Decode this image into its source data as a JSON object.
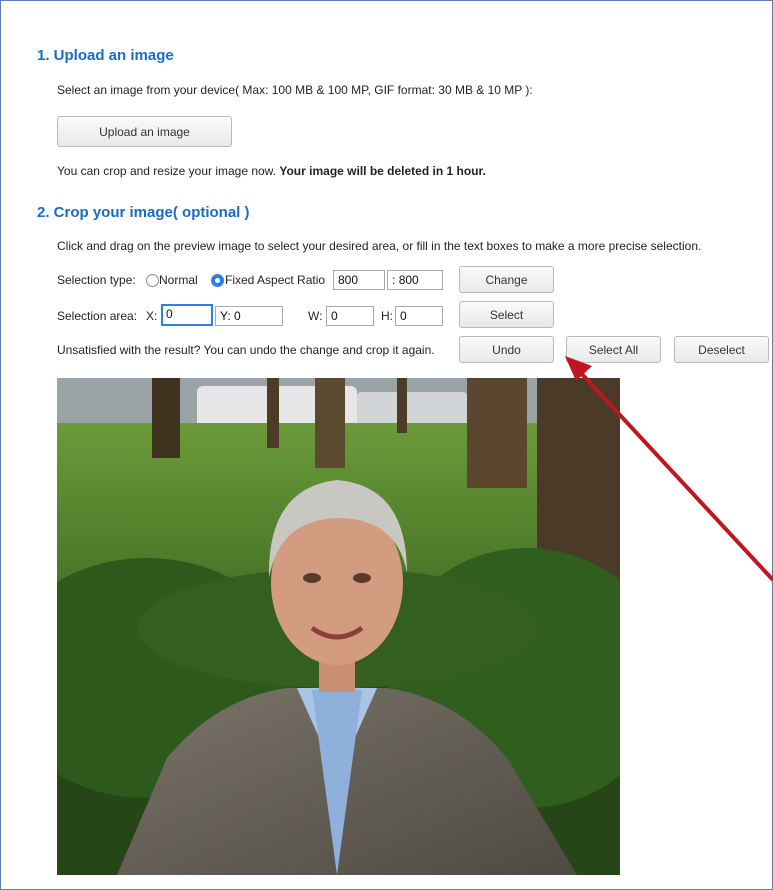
{
  "section1": {
    "heading": "1. Upload an image",
    "description": "Select an image from your device( Max: 100 MB & 100 MP, GIF format: 30 MB & 10 MP ):",
    "upload_button": "Upload an image",
    "note_prefix": "You can crop and resize your image now. ",
    "note_bold": "Your image will be deleted in 1 hour."
  },
  "section2": {
    "heading": "2. Crop your image( optional )",
    "instructions": "Click and drag on the preview image to select your desired area, or fill in the text boxes to make a more precise selection.",
    "selection_type": {
      "label": "Selection type:",
      "option_normal": "Normal",
      "option_fixed": "Fixed Aspect Ratio",
      "selected": "Fixed Aspect Ratio",
      "ratio_width": "800",
      "ratio_separator": ":",
      "ratio_height": "800",
      "change_button": "Change"
    },
    "selection_area": {
      "label": "Selection area:",
      "x_label": "X:",
      "x_value": "0",
      "y_label": "Y:",
      "y_value": "0",
      "w_label": "W:",
      "w_value": "0",
      "h_label": "H:",
      "h_value": "0",
      "select_button": "Select"
    },
    "undo_row": {
      "text": "Unsatisfied with the result? You can undo the change and crop it again.",
      "undo_button": "Undo",
      "select_all_button": "Select All",
      "deselect_button": "Deselect"
    }
  },
  "annotation": {
    "arrow_color": "#c0161f"
  },
  "colors": {
    "heading": "#1a6bc1",
    "radio_accent": "#2f7ef0"
  }
}
